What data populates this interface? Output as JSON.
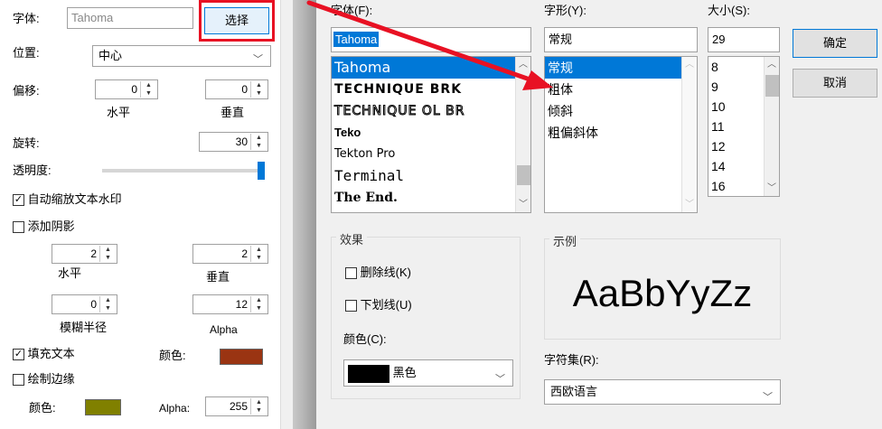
{
  "left_panel": {
    "font_label": "字体:",
    "font_value": "Tahoma",
    "select_button": "选择",
    "position_label": "位置:",
    "position_value": "中心",
    "offset_label": "偏移:",
    "offset_h": "0",
    "offset_v": "0",
    "horizontal": "水平",
    "vertical": "垂直",
    "rotate_label": "旋转:",
    "rotate_value": "30",
    "opacity_label": "透明度:",
    "opacity_level": 0.98,
    "auto_scale": "自动缩放文本水印",
    "auto_scale_checked": true,
    "add_shadow": "添加阴影",
    "add_shadow_checked": false,
    "shadow_h": "2",
    "shadow_v": "2",
    "shadow_horizontal": "水平",
    "shadow_vertical": "垂直",
    "blur_value": "0",
    "alpha_value": "12",
    "blur_label": "模糊半径",
    "alpha_label": "Alpha",
    "fill_text": "填充文本",
    "fill_text_checked": true,
    "color_label": "颜色:",
    "fill_color": "#9a3412",
    "draw_edge": "绘制边缘",
    "draw_edge_checked": false,
    "edge_color_label": "颜色:",
    "edge_color": "#808000",
    "edge_alpha_label": "Alpha:",
    "edge_alpha_value": "255"
  },
  "dialog": {
    "font_label": "字体(F):",
    "font_input": "Tahoma",
    "font_list": [
      "Tahoma",
      "TECHNIQUE BRK",
      "TECHNIQUE OL BR",
      "Teko",
      "Tekton Pro",
      "Terminal",
      "The End."
    ],
    "style_label": "字形(Y):",
    "style_input": "常规",
    "style_list": [
      "常规",
      "粗体",
      "倾斜",
      "粗偏斜体"
    ],
    "size_label": "大小(S):",
    "size_input": "29",
    "size_list": [
      "8",
      "9",
      "10",
      "11",
      "12",
      "14",
      "16"
    ],
    "ok_button": "确定",
    "cancel_button": "取消",
    "effects_title": "效果",
    "strikeout": "删除线(K)",
    "underline": "下划线(U)",
    "color_label": "颜色(C):",
    "color_value": "黑色",
    "color_swatch": "#000000",
    "sample_title": "示例",
    "sample_text": "AaBbYyZz",
    "charset_label": "字符集(R):",
    "charset_value": "西欧语言"
  },
  "colors": {
    "highlight": "#0078d7",
    "annotation_red": "#e81123"
  }
}
